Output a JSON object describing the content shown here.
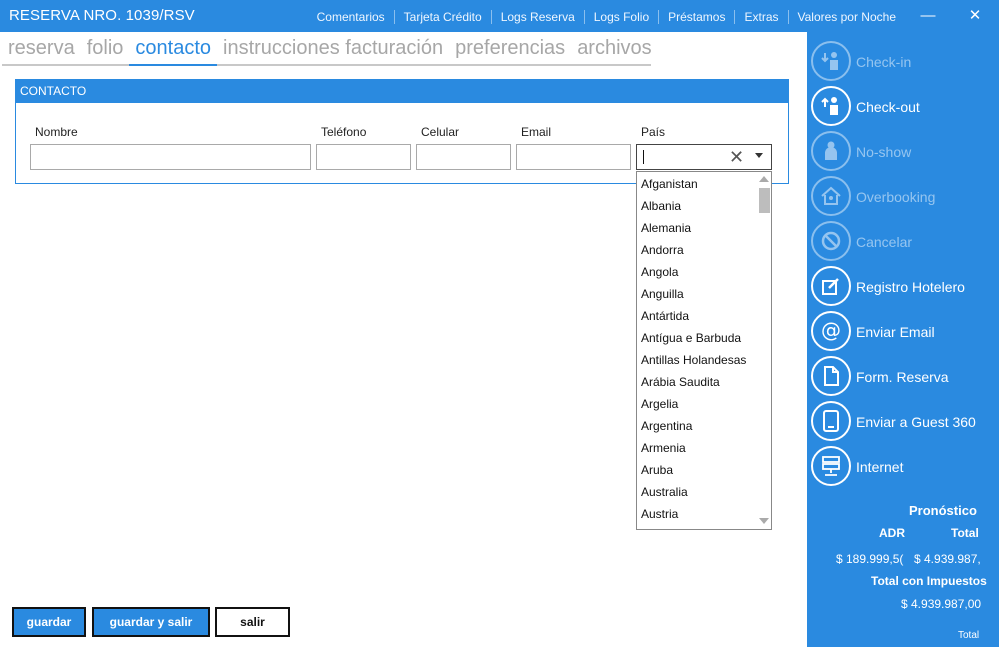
{
  "window": {
    "title": "RESERVA NRO. 1039/RSV",
    "links": [
      "Comentarios",
      "Tarjeta Crédito",
      "Logs Reserva",
      "Logs Folio",
      "Préstamos",
      "Extras",
      "Valores por Noche"
    ],
    "minimize_symbol": "—",
    "close_symbol": "✕"
  },
  "tabs": [
    "reserva",
    "folio",
    "contacto",
    "instrucciones facturación",
    "preferencias",
    "archivos"
  ],
  "active_tab": "contacto",
  "contact_panel": {
    "header": "CONTACTO",
    "labels": {
      "nombre": "Nombre",
      "telefono": "Teléfono",
      "celular": "Celular",
      "email": "Email",
      "pais": "País"
    },
    "values": {
      "nombre": "",
      "telefono": "",
      "celular": "",
      "email": "",
      "pais": ""
    },
    "clear_symbol": "✕"
  },
  "country_options": [
    "Afganistan",
    "Albania",
    "Alemania",
    "Andorra",
    "Angola",
    "Anguilla",
    "Antártida",
    "Antígua e Barbuda",
    "Antillas Holandesas",
    "Arábia Saudita",
    "Argelia",
    "Argentina",
    "Armenia",
    "Aruba",
    "Australia",
    "Austria"
  ],
  "buttons": {
    "guardar": "guardar",
    "guardar_salir": "guardar y salir",
    "salir": "salir"
  },
  "sidebar": {
    "actions": [
      {
        "label": "Check-in",
        "icon": "check-in-icon",
        "enabled": false
      },
      {
        "label": "Check-out",
        "icon": "check-out-icon",
        "enabled": true
      },
      {
        "label": "No-show",
        "icon": "no-show-icon",
        "enabled": false
      },
      {
        "label": "Overbooking",
        "icon": "overbooking-icon",
        "enabled": false
      },
      {
        "label": "Cancelar",
        "icon": "cancel-icon",
        "enabled": false
      },
      {
        "label": "Registro Hotelero",
        "icon": "edit-icon",
        "enabled": true
      },
      {
        "label": "Enviar Email",
        "icon": "at-icon",
        "enabled": true
      },
      {
        "label": "Form. Reserva",
        "icon": "document-icon",
        "enabled": true
      },
      {
        "label": "Enviar a Guest 360",
        "icon": "tablet-icon",
        "enabled": true
      },
      {
        "label": "Internet",
        "icon": "network-icon",
        "enabled": true
      }
    ],
    "forecast": {
      "title": "Pronóstico",
      "adr_label": "ADR",
      "total_label": "Total",
      "adr_value": "$ 189.999,5(",
      "total_value": "$ 4.939.987,",
      "total_tax_label": "Total con Impuestos",
      "total_tax_value": "$ 4.939.987,00",
      "footer_label": "Total"
    }
  },
  "colors": {
    "accent": "#2a8ae0",
    "tab_inactive": "#a7a7a7",
    "sidebar_bg": "#2a8ae0"
  }
}
